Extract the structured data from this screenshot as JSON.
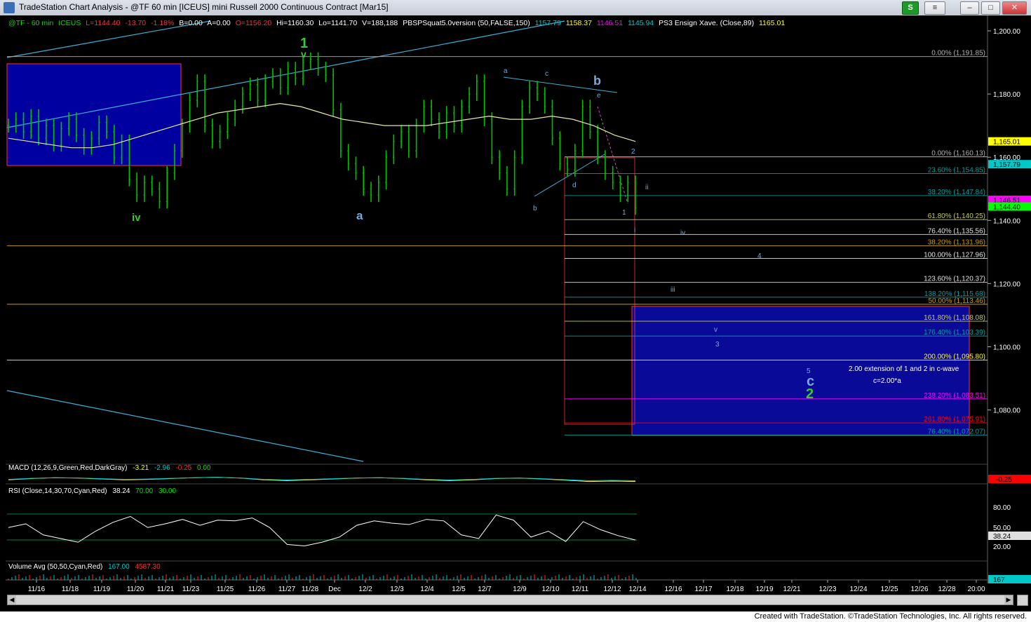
{
  "window": {
    "title": "TradeStation Chart Analysis - @TF 60 min [ICEUS] mini Russell 2000 Continuous Contract [Mar15]",
    "s_button": "S",
    "ctrl_button": "≡",
    "colors": {
      "up": "#00c000",
      "bg": "#000000"
    }
  },
  "footer": "Created with TradeStation. ©TradeStation Technologies, Inc. All rights reserved.",
  "chart_data": {
    "type": "line",
    "symbol_header": {
      "symbol": "@TF - 60 min",
      "exchange": "ICEUS",
      "last": "L=1144.40",
      "change": "-13.70",
      "change_pct": "-1.18%",
      "bid": "B=0.00",
      "ask": "A=0.00",
      "open": "O=1156.20",
      "high": "Hi=1160.30",
      "low": "Lo=1141.70",
      "volume": "V=188,188",
      "study": "PBSPSquat5.0version (50,FALSE,150)",
      "study_v1": "1157.79",
      "study_v2": "1158.37",
      "study_v3": "1146.51",
      "study_v4": "1145.94",
      "study2": "PS3 Ensign Xave. (Close,89)",
      "study2_v": "1165.01"
    },
    "price_axis": {
      "min": 1065,
      "max": 1202,
      "ticks": [
        "1,200.00",
        "1,180.00",
        "1,160.00",
        "1,140.00",
        "1,120.00",
        "1,100.00",
        "1,080.00"
      ]
    },
    "x_ticks": [
      "11/16",
      "11/18",
      "11/19",
      "11/20",
      "11/21",
      "11/23",
      "11/25",
      "11/26",
      "11/27",
      "11/28",
      "Dec",
      "12/2",
      "12/3",
      "12/4",
      "12/5",
      "12/7",
      "12/9",
      "12/10",
      "12/11",
      "12/12",
      "12/14",
      "12/16",
      "12/17",
      "12/18",
      "12/19",
      "12/21",
      "12/23",
      "12/24",
      "12/25",
      "12/26",
      "12/28",
      "20:00"
    ],
    "price_series": [
      1170,
      1172,
      1168,
      1173,
      1166,
      1170,
      1164,
      1169,
      1172,
      1167,
      1163,
      1166,
      1171,
      1168,
      1160,
      1165,
      1153,
      1148,
      1152,
      1150,
      1146,
      1155,
      1162,
      1170,
      1178,
      1184,
      1170,
      1165,
      1168,
      1172,
      1176,
      1180,
      1183,
      1178,
      1184,
      1186,
      1182,
      1188,
      1185,
      1190,
      1191,
      1188,
      1186,
      1175,
      1162,
      1158,
      1155,
      1150,
      1148,
      1152,
      1160,
      1165,
      1168,
      1162,
      1170,
      1176,
      1172,
      1168,
      1174,
      1170,
      1176,
      1180,
      1184,
      1172,
      1160,
      1155,
      1150,
      1160,
      1176,
      1182,
      1180,
      1176,
      1166,
      1158,
      1156,
      1162,
      1176,
      1168,
      1160,
      1155,
      1152,
      1148,
      1152,
      1144
    ],
    "moving_average": [
      1166,
      1165,
      1164,
      1163,
      1163,
      1164,
      1166,
      1168,
      1170,
      1172,
      1174,
      1175,
      1176,
      1177,
      1176,
      1174,
      1172,
      1171,
      1170,
      1170,
      1170,
      1171,
      1172,
      1173,
      1172,
      1172,
      1173,
      1172,
      1170,
      1167,
      1165
    ],
    "macd_series": [
      -1,
      0.5,
      1.5,
      1,
      0,
      -1,
      -0.5,
      0.5,
      1.5,
      2,
      1,
      -1,
      -2,
      -1,
      0,
      1,
      1.5,
      0.5,
      -1,
      -2,
      -1,
      0.5,
      1,
      0,
      -1.5,
      -3,
      -2.5,
      -3
    ],
    "rsi_series": [
      55,
      60,
      45,
      40,
      35,
      50,
      62,
      70,
      55,
      60,
      66,
      58,
      65,
      64,
      68,
      55,
      32,
      30,
      35,
      42,
      58,
      64,
      61,
      59,
      66,
      64,
      45,
      40,
      72,
      65,
      42,
      50,
      36,
      63,
      52,
      44,
      38
    ],
    "fib_levels_upper": [
      {
        "label": "0.00% (1,191.85)",
        "value": 1191.85,
        "color": "#b0b0b0"
      },
      {
        "label": "0.00% (1,160.13)",
        "value": 1160.13,
        "color": "#b0b0b0"
      },
      {
        "label": "23.60% (1,154.85)",
        "value": 1154.85,
        "color": "#00a0a0"
      },
      {
        "label": "38.20% (1,147.84)",
        "value": 1147.84,
        "color": "#00a0a0"
      },
      {
        "label": "61.80% (1,140.25)",
        "value": 1140.25,
        "color": "#c8c860"
      },
      {
        "label": "76.40% (1,135.56)",
        "value": 1135.56,
        "color": "#e0e0e0"
      },
      {
        "label": "38.20% (1,131.96)",
        "value": 1131.96,
        "color": "#c8a000"
      },
      {
        "label": "100.00% (1,127.96)",
        "value": 1127.96,
        "color": "#e0e0e0"
      },
      {
        "label": "123.60% (1,120.37)",
        "value": 1120.37,
        "color": "#e0e0e0"
      },
      {
        "label": "138.20% (1,115.68)",
        "value": 1115.68,
        "color": "#00a0a0"
      },
      {
        "label": "50.00% (1,113.46)",
        "value": 1113.46,
        "color": "#c8a000"
      },
      {
        "label": "161.80% (1,108.08)",
        "value": 1108.08,
        "color": "#c8c860"
      },
      {
        "label": "176.40% (1,103.39)",
        "value": 1103.39,
        "color": "#00a0a0"
      },
      {
        "label": "200.00% (1,095.80)",
        "value": 1095.8,
        "color": "#ffff00"
      },
      {
        "label": "238.20% (1,083.51)",
        "value": 1083.51,
        "color": "#ff00ff"
      },
      {
        "label": "261.80% (1,075.91)",
        "value": 1075.91,
        "color": "#ff0000"
      },
      {
        "label": "76.40% (1,072.07)",
        "value": 1072.07,
        "color": "#00a0a0"
      }
    ],
    "price_tags": [
      {
        "text": "1,165.01",
        "value": 1165.01,
        "bg": "#ffff00"
      },
      {
        "text": "1,157.79",
        "value": 1157.79,
        "bg": "#00c8c8"
      },
      {
        "text": "1,146.51",
        "value": 1146.51,
        "bg": "#ff00ff"
      },
      {
        "text": "1,144.40",
        "value": 1144.4,
        "bg": "#00ff00"
      }
    ],
    "wave_labels_big": [
      {
        "text": "1",
        "color": "#33cc33"
      },
      {
        "text": "b",
        "color": "#7aa8d8"
      },
      {
        "text": "a",
        "color": "#7aa8d8"
      },
      {
        "text": "iv",
        "color": "#33cc33"
      },
      {
        "text": "c",
        "color": "#7aa8d8"
      },
      {
        "text": "2",
        "color": "#33cc33"
      }
    ],
    "wave_labels_small": [
      "v",
      "a",
      "c",
      "e",
      "d",
      "b",
      "2",
      "ii",
      "1",
      "i",
      "iv",
      "4",
      "iii",
      "v",
      "3",
      "5"
    ],
    "annotations": [
      "2.00 extension of 1 and 2 in c-wave",
      "c=2.00*a"
    ],
    "macd_header": {
      "label": "MACD (12,26,9,Green,Red,DarkGray)",
      "v1": "-3.21",
      "v2": "-2.96",
      "v3": "-0.25",
      "v4": "0.00"
    },
    "macd_axis_tag": "-0.25",
    "rsi_header": {
      "label": "RSI (Close,14,30,70,Cyan,Red)",
      "v1": "38.24",
      "v2": "70.00",
      "v3": "30.00"
    },
    "rsi_ticks": [
      "80.00",
      "50.00",
      "20.00"
    ],
    "rsi_tag": "38.24",
    "vol_header": {
      "label": "Volume Avg (50,50,Cyan,Red)",
      "v1": "167.00",
      "v2": "4587.30"
    },
    "vol_tag": "167"
  }
}
